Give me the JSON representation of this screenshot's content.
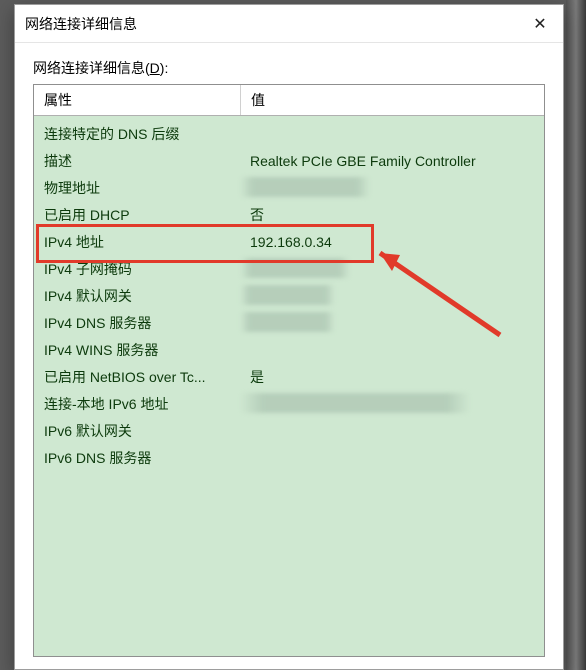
{
  "window": {
    "title": "网络连接详细信息",
    "close_glyph": "✕"
  },
  "list_label_prefix": "网络连接详细信息(",
  "list_label_hotkey": "D",
  "list_label_suffix": "):",
  "columns": {
    "property": "属性",
    "value": "值"
  },
  "rows": [
    {
      "prop": "连接特定的 DNS 后缀",
      "val": ""
    },
    {
      "prop": "描述",
      "val": "Realtek PCIe GBE Family Controller"
    },
    {
      "prop": "物理地址",
      "val": ""
    },
    {
      "prop": "已启用 DHCP",
      "val": "否"
    },
    {
      "prop": "IPv4 地址",
      "val": "192.168.0.34"
    },
    {
      "prop": "IPv4 子网掩码",
      "val": ""
    },
    {
      "prop": "IPv4 默认网关",
      "val": ""
    },
    {
      "prop": "IPv4 DNS 服务器",
      "val": ""
    },
    {
      "prop": "IPv4 WINS 服务器",
      "val": ""
    },
    {
      "prop": "已启用 NetBIOS over Tc...",
      "val": "是"
    },
    {
      "prop": "连接-本地 IPv6 地址",
      "val": ""
    },
    {
      "prop": "IPv6 默认网关",
      "val": ""
    },
    {
      "prop": "IPv6 DNS 服务器",
      "val": ""
    }
  ],
  "annotation": {
    "highlight_row_index": 4,
    "arrow_color": "#e13a2a"
  }
}
